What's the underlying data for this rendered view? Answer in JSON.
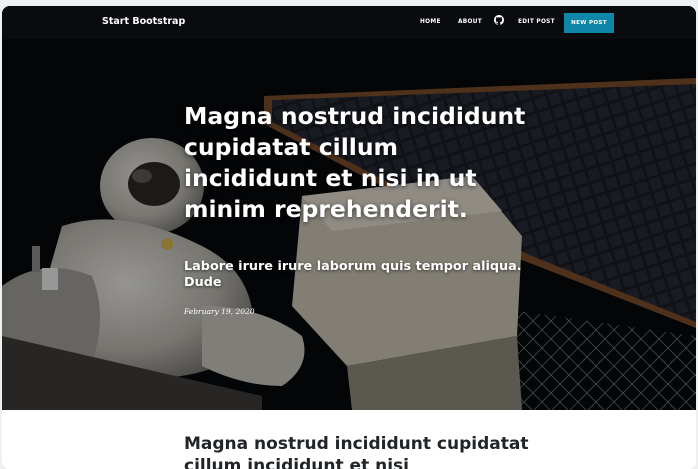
{
  "navbar": {
    "brand": "Start Bootstrap",
    "items": [
      {
        "label": "HOME"
      },
      {
        "label": "ABOUT"
      },
      {
        "label": "EDIT POST"
      }
    ],
    "github_icon": "github-icon",
    "new_post_label": "NEW POST",
    "new_post_color": "#0f85a8"
  },
  "hero": {
    "title": "Magna nostrud incididunt cupidatat cillum incididunt et nisi in ut minim reprehenderit.",
    "subtitle": "Labore irure irure laborum quis tempor aliqua. Dude",
    "date": "February 19, 2020",
    "background_image": "astronaut-spacewalk-photo"
  },
  "post": {
    "title": "Magna nostrud incididunt cupidatat cillum incididunt et nisi"
  }
}
